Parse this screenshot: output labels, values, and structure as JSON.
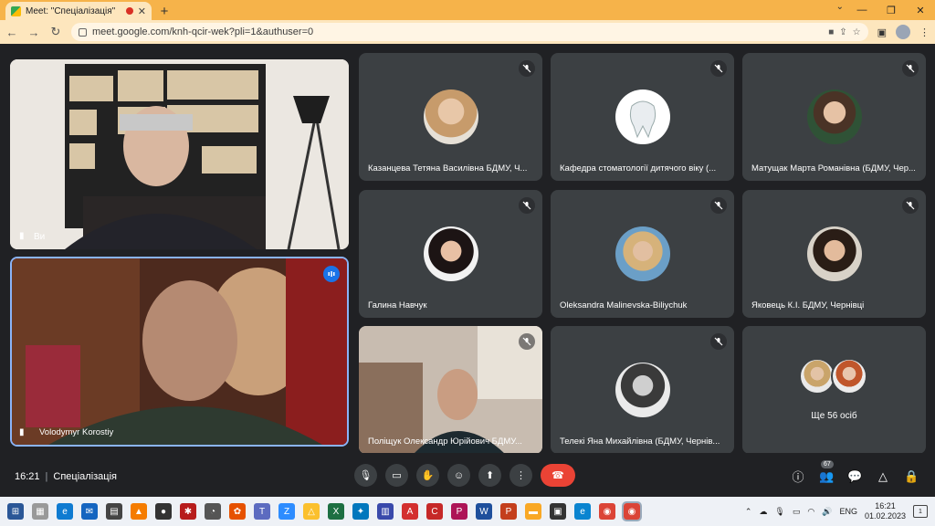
{
  "browser": {
    "tab_title": "Meet: \"Спеціалізація\"",
    "new_tab": "+",
    "url": "meet.google.com/knh-qcir-wek?pli=1&authuser=0"
  },
  "meet": {
    "self_tile_label": "Ви",
    "speaker_name": "Volodymyr Korostiy",
    "participants": [
      {
        "name": "Казанцева Тетяна Василівна БДМУ, Ч..."
      },
      {
        "name": "Кафедра стоматології дитячого віку (..."
      },
      {
        "name": "Матущак Марта Романівна (БДМУ, Чер..."
      },
      {
        "name": "Галина Навчук"
      },
      {
        "name": "Oleksandra Malinevska-Biliychuk"
      },
      {
        "name": "Яковець К.І. БДМУ, Чернівці"
      },
      {
        "name": "Поліщук Олександр Юрійович БДМУ..."
      },
      {
        "name": "Телекі Яна Михайлівна (БДМУ, Чернів..."
      }
    ],
    "others_label": "Ще 56 осіб",
    "time": "16:21",
    "meeting_name": "Спеціалізація",
    "participants_count": "67"
  },
  "taskbar": {
    "lang": "ENG",
    "time": "16:21",
    "date": "01.02.2023",
    "notifications": "1"
  },
  "colors": {
    "tab_bar": "#f6b34a",
    "end_call": "#ea4335",
    "tile_bg": "#3c4043",
    "speaking_outline": "#8ab4f8"
  }
}
